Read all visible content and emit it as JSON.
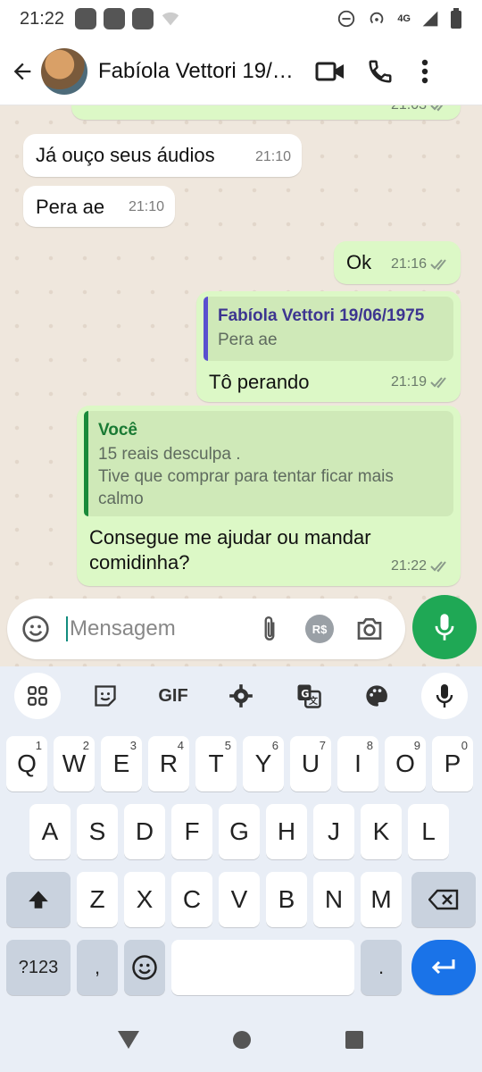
{
  "status_bar": {
    "time": "21:22",
    "network": "4G"
  },
  "header": {
    "contact_name": "Fabíola Vettori 19/06/1975"
  },
  "messages": [
    {
      "dir": "in",
      "text": "Já ouço seus áudios",
      "time": "21:10"
    },
    {
      "dir": "in",
      "text": "Pera ae",
      "time": "21:10"
    },
    {
      "dir": "out",
      "text": "Ok",
      "time": "21:16"
    },
    {
      "dir": "out",
      "quote_author": "Fabíola Vettori 19/06/1975",
      "quote_text": "Pera ae",
      "text": "Tô perando",
      "time": "21:19"
    },
    {
      "dir": "out",
      "quote_author": "Você",
      "quote_text": "15 reais desculpa .\n Tive que comprar para tentar ficar mais calmo",
      "text": "Consegue me ajudar ou mandar comidinha?",
      "time": "21:22"
    }
  ],
  "partial_top": {
    "time": "21:03"
  },
  "composer": {
    "placeholder": "Mensagem",
    "payment_label": "R$"
  },
  "keyboard": {
    "toolbar": [
      "apps-icon",
      "sticker-icon",
      "GIF",
      "settings-icon",
      "translate-icon",
      "palette-icon",
      "mic-icon"
    ],
    "row1": [
      [
        "Q",
        "1"
      ],
      [
        "W",
        "2"
      ],
      [
        "E",
        "3"
      ],
      [
        "R",
        "4"
      ],
      [
        "T",
        "5"
      ],
      [
        "Y",
        "6"
      ],
      [
        "U",
        "7"
      ],
      [
        "I",
        "8"
      ],
      [
        "O",
        "9"
      ],
      [
        "P",
        "0"
      ]
    ],
    "row2": [
      "A",
      "S",
      "D",
      "F",
      "G",
      "H",
      "J",
      "K",
      "L"
    ],
    "row3": [
      "Z",
      "X",
      "C",
      "V",
      "B",
      "N",
      "M"
    ],
    "symbols_key": "?123",
    "comma_key": ",",
    "period_key": "."
  },
  "colors": {
    "accent_green": "#1fa855",
    "outgoing_bubble": "#dcf8c6",
    "quote_purple": "#5a4fcf",
    "quote_green": "#1a8a3a",
    "enter_blue": "#1a73e8"
  }
}
